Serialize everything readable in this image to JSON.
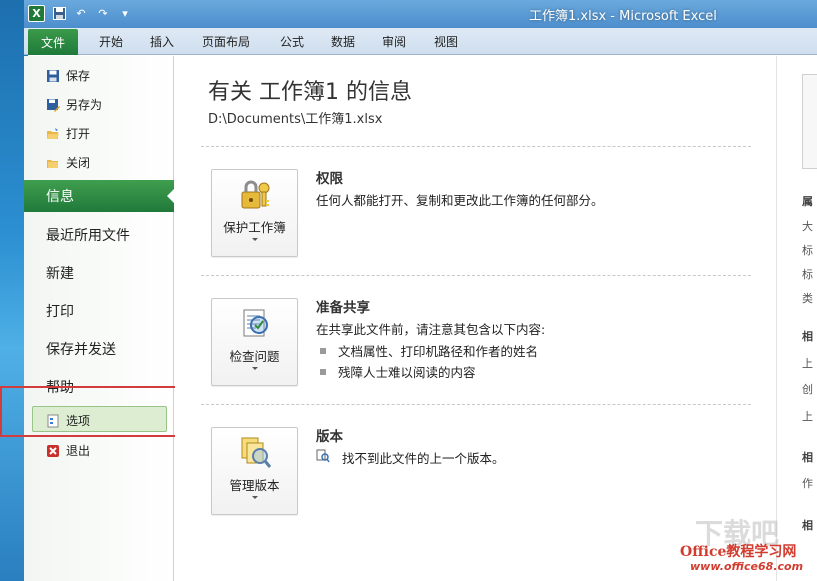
{
  "window": {
    "title": "工作簿1.xlsx  -  Microsoft Excel",
    "app_icon_letter": "X"
  },
  "quick_access": [
    {
      "name": "save-icon",
      "glyph": "▪"
    },
    {
      "name": "undo-icon",
      "glyph": "↶"
    },
    {
      "name": "redo-icon",
      "glyph": "↷"
    },
    {
      "name": "customize-icon",
      "glyph": "▾"
    }
  ],
  "ribbon": {
    "file_tab": "文件",
    "tabs": [
      "开始",
      "插入",
      "页面布局",
      "公式",
      "数据",
      "审阅",
      "视图"
    ]
  },
  "backstage": {
    "commands": [
      {
        "label": "保存",
        "icon": "save-icon"
      },
      {
        "label": "另存为",
        "icon": "save-as-icon"
      },
      {
        "label": "打开",
        "icon": "open-folder-icon"
      },
      {
        "label": "关闭",
        "icon": "close-folder-icon"
      }
    ],
    "active_tab": "信息",
    "tabs": [
      "最近所用文件",
      "新建",
      "打印",
      "保存并发送",
      "帮助"
    ],
    "options_label": "选项",
    "exit_label": "退出"
  },
  "info": {
    "title": "有关 工作簿1 的信息",
    "path": "D:\\Documents\\工作簿1.xlsx",
    "sections": [
      {
        "button_label": "保护工作簿",
        "icon": "key-lock-icon",
        "heading": "权限",
        "description": "任何人都能打开、复制和更改此工作簿的任何部分。",
        "bullets": []
      },
      {
        "button_label": "检查问题",
        "icon": "inspect-checklist-icon",
        "heading": "准备共享",
        "description": "在共享此文件前，请注意其包含以下内容:",
        "bullets": [
          "文档属性、打印机路径和作者的姓名",
          "残障人士难以阅读的内容"
        ]
      },
      {
        "button_label": "管理版本",
        "icon": "manage-versions-icon",
        "heading": "版本",
        "description": "找不到此文件的上一个版本。",
        "bullets": []
      }
    ]
  },
  "properties_pane": {
    "labels": [
      "属",
      "大",
      "标",
      "标",
      "类",
      "相",
      "上",
      "创",
      "上",
      "相",
      "作",
      "相"
    ]
  },
  "watermark": {
    "line1": "Office教程学习网",
    "line2": "www.office68.com",
    "ghost": "下载吧"
  },
  "colors": {
    "accent_green": "#1f7a3a",
    "title_blue": "#4d8ecd",
    "highlight_red": "#d33c3c"
  }
}
